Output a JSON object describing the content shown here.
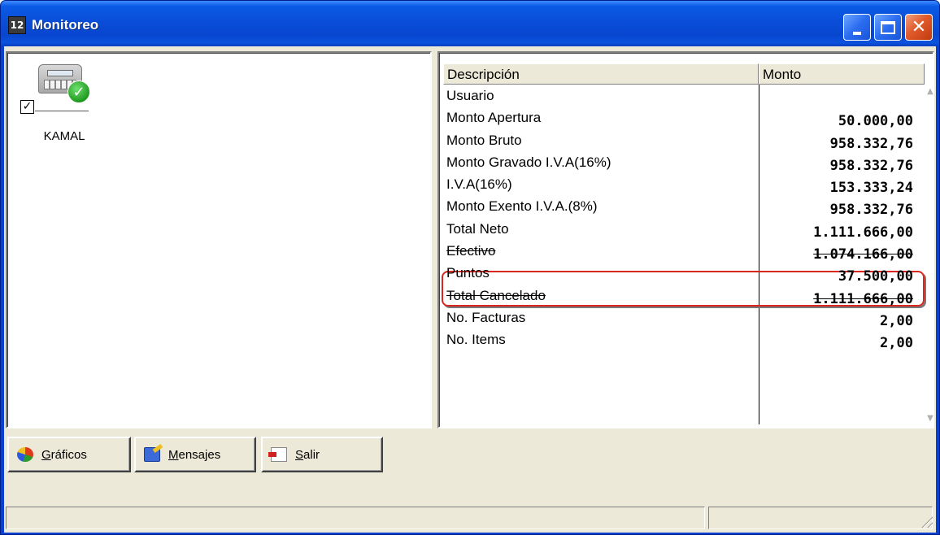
{
  "window": {
    "title": "Monitoreo",
    "app_icon_glyph": "12"
  },
  "titlebar_buttons": {
    "minimize": "minimize-icon",
    "maximize": "maximize-icon",
    "close": "close-icon",
    "close_glyph": "✕"
  },
  "left_panel": {
    "register": {
      "name": "KAMAL",
      "checked": true,
      "check_glyph": "✓",
      "checkbox_glyph": "☑"
    }
  },
  "grid": {
    "headers": {
      "description": "Descripción",
      "amount": "Monto"
    },
    "rows": [
      {
        "description": "Usuario",
        "amount": ""
      },
      {
        "description": "Monto Apertura",
        "amount": "50.000,00"
      },
      {
        "description": "Monto Bruto",
        "amount": "958.332,76"
      },
      {
        "description": "Monto Gravado I.V.A(16%)",
        "amount": "958.332,76"
      },
      {
        "description": "I.V.A(16%)",
        "amount": "153.333,24"
      },
      {
        "description": "Monto Exento I.V.A.(8%)",
        "amount": "958.332,76"
      },
      {
        "description": "Total Neto",
        "amount": "1.111.666,00"
      },
      {
        "description": "Efectivo",
        "amount": "1.074.166,00"
      },
      {
        "description": "Puntos",
        "amount": "37.500,00"
      },
      {
        "description": "Total Cancelado",
        "amount": "1.111.666,00"
      },
      {
        "description": "No. Facturas",
        "amount": "2,00"
      },
      {
        "description": "No. Items",
        "amount": "2,00"
      }
    ],
    "scroll_up_glyph": "▲",
    "scroll_down_glyph": "▼"
  },
  "buttons": {
    "graficos": {
      "label_first": "G",
      "label_rest": "ráficos"
    },
    "mensajes": {
      "label_first": "M",
      "label_rest": "ensajes"
    },
    "salir": {
      "label_first": "S",
      "label_rest": "alir"
    }
  },
  "colors": {
    "titlebar": "#0a4ed8",
    "highlight": "#d8271f",
    "face": "#ece9d8"
  }
}
